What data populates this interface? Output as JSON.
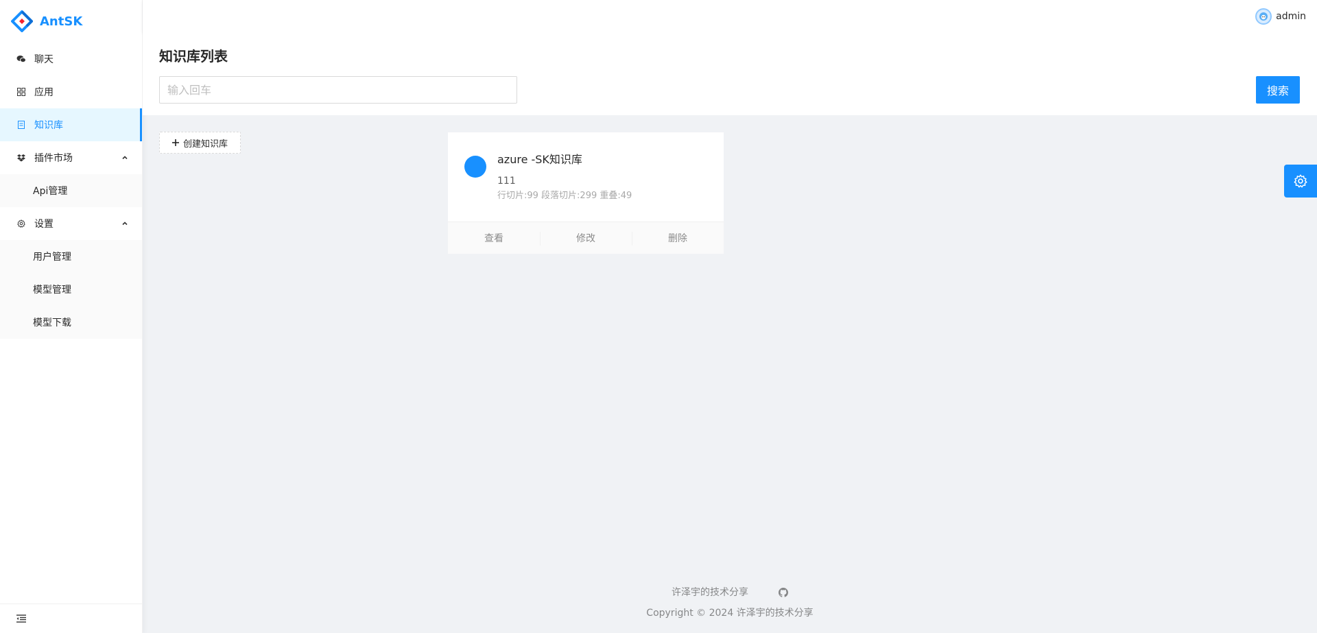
{
  "app": {
    "name": "AntSK"
  },
  "sidebar": {
    "items": [
      {
        "label": "聊天",
        "icon": "wechat-icon",
        "active": false
      },
      {
        "label": "应用",
        "icon": "appstore-icon",
        "active": false
      },
      {
        "label": "知识库",
        "icon": "book-icon",
        "active": true
      },
      {
        "label": "插件市场",
        "icon": "dropbox-icon",
        "expanded": true,
        "children": [
          {
            "label": "Api管理"
          }
        ]
      },
      {
        "label": "设置",
        "icon": "setting-icon",
        "expanded": true,
        "children": [
          {
            "label": "用户管理"
          },
          {
            "label": "模型管理"
          },
          {
            "label": "模型下载"
          }
        ]
      }
    ],
    "collapse_icon": "menu-fold-icon"
  },
  "header": {
    "username": "admin"
  },
  "page": {
    "title": "知识库列表",
    "search": {
      "placeholder": "输入回车",
      "value": ""
    },
    "search_button": "搜索",
    "create_button": "创建知识库"
  },
  "kms": [
    {
      "title": "azure -SK知识库",
      "description": "111",
      "stats": "行切片:99 段落切片:299 重叠:49",
      "actions": [
        "查看",
        "修改",
        "删除"
      ]
    }
  ],
  "footer": {
    "link_text": "许泽宇的技术分享",
    "copyright": "Copyright © 2024 许泽宇的技术分享"
  },
  "colors": {
    "primary": "#1890ff",
    "background": "#f0f2f5"
  }
}
